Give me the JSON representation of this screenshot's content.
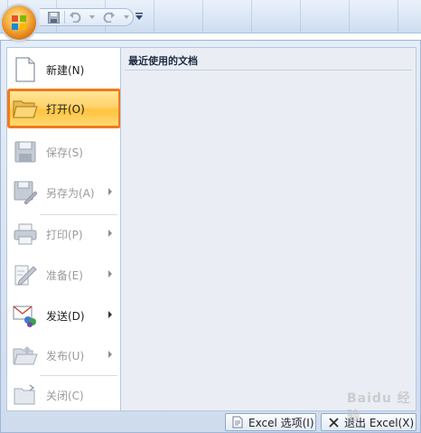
{
  "quick_access": {
    "customize_glyph": "▾"
  },
  "menu": {
    "items": [
      {
        "label": "新建(N)",
        "icon": "new-document-icon",
        "enabled": true,
        "submenu": false
      },
      {
        "label": "打开(O)",
        "icon": "open-folder-icon",
        "enabled": true,
        "submenu": false,
        "selected": true
      },
      {
        "label": "保存(S)",
        "icon": "save-disk-icon",
        "enabled": false,
        "submenu": false
      },
      {
        "label": "另存为(A)",
        "icon": "save-as-icon",
        "enabled": false,
        "submenu": true
      },
      {
        "label": "打印(P)",
        "icon": "printer-icon",
        "enabled": false,
        "submenu": true
      },
      {
        "label": "准备(E)",
        "icon": "prepare-icon",
        "enabled": false,
        "submenu": true
      },
      {
        "label": "发送(D)",
        "icon": "send-icon",
        "enabled": true,
        "submenu": true
      },
      {
        "label": "发布(U)",
        "icon": "publish-icon",
        "enabled": false,
        "submenu": true
      },
      {
        "label": "关闭(C)",
        "icon": "close-folder-icon",
        "enabled": false,
        "submenu": false
      }
    ]
  },
  "recent": {
    "title": "最近使用的文档"
  },
  "footer": {
    "options_label": "Excel 选项(I)",
    "exit_label": "退出 Excel(X)"
  },
  "watermark": {
    "text": "Baidu 经验"
  },
  "colors": {
    "selected_outline": "#f07a1c",
    "selected_fill": "#ffd36a"
  }
}
